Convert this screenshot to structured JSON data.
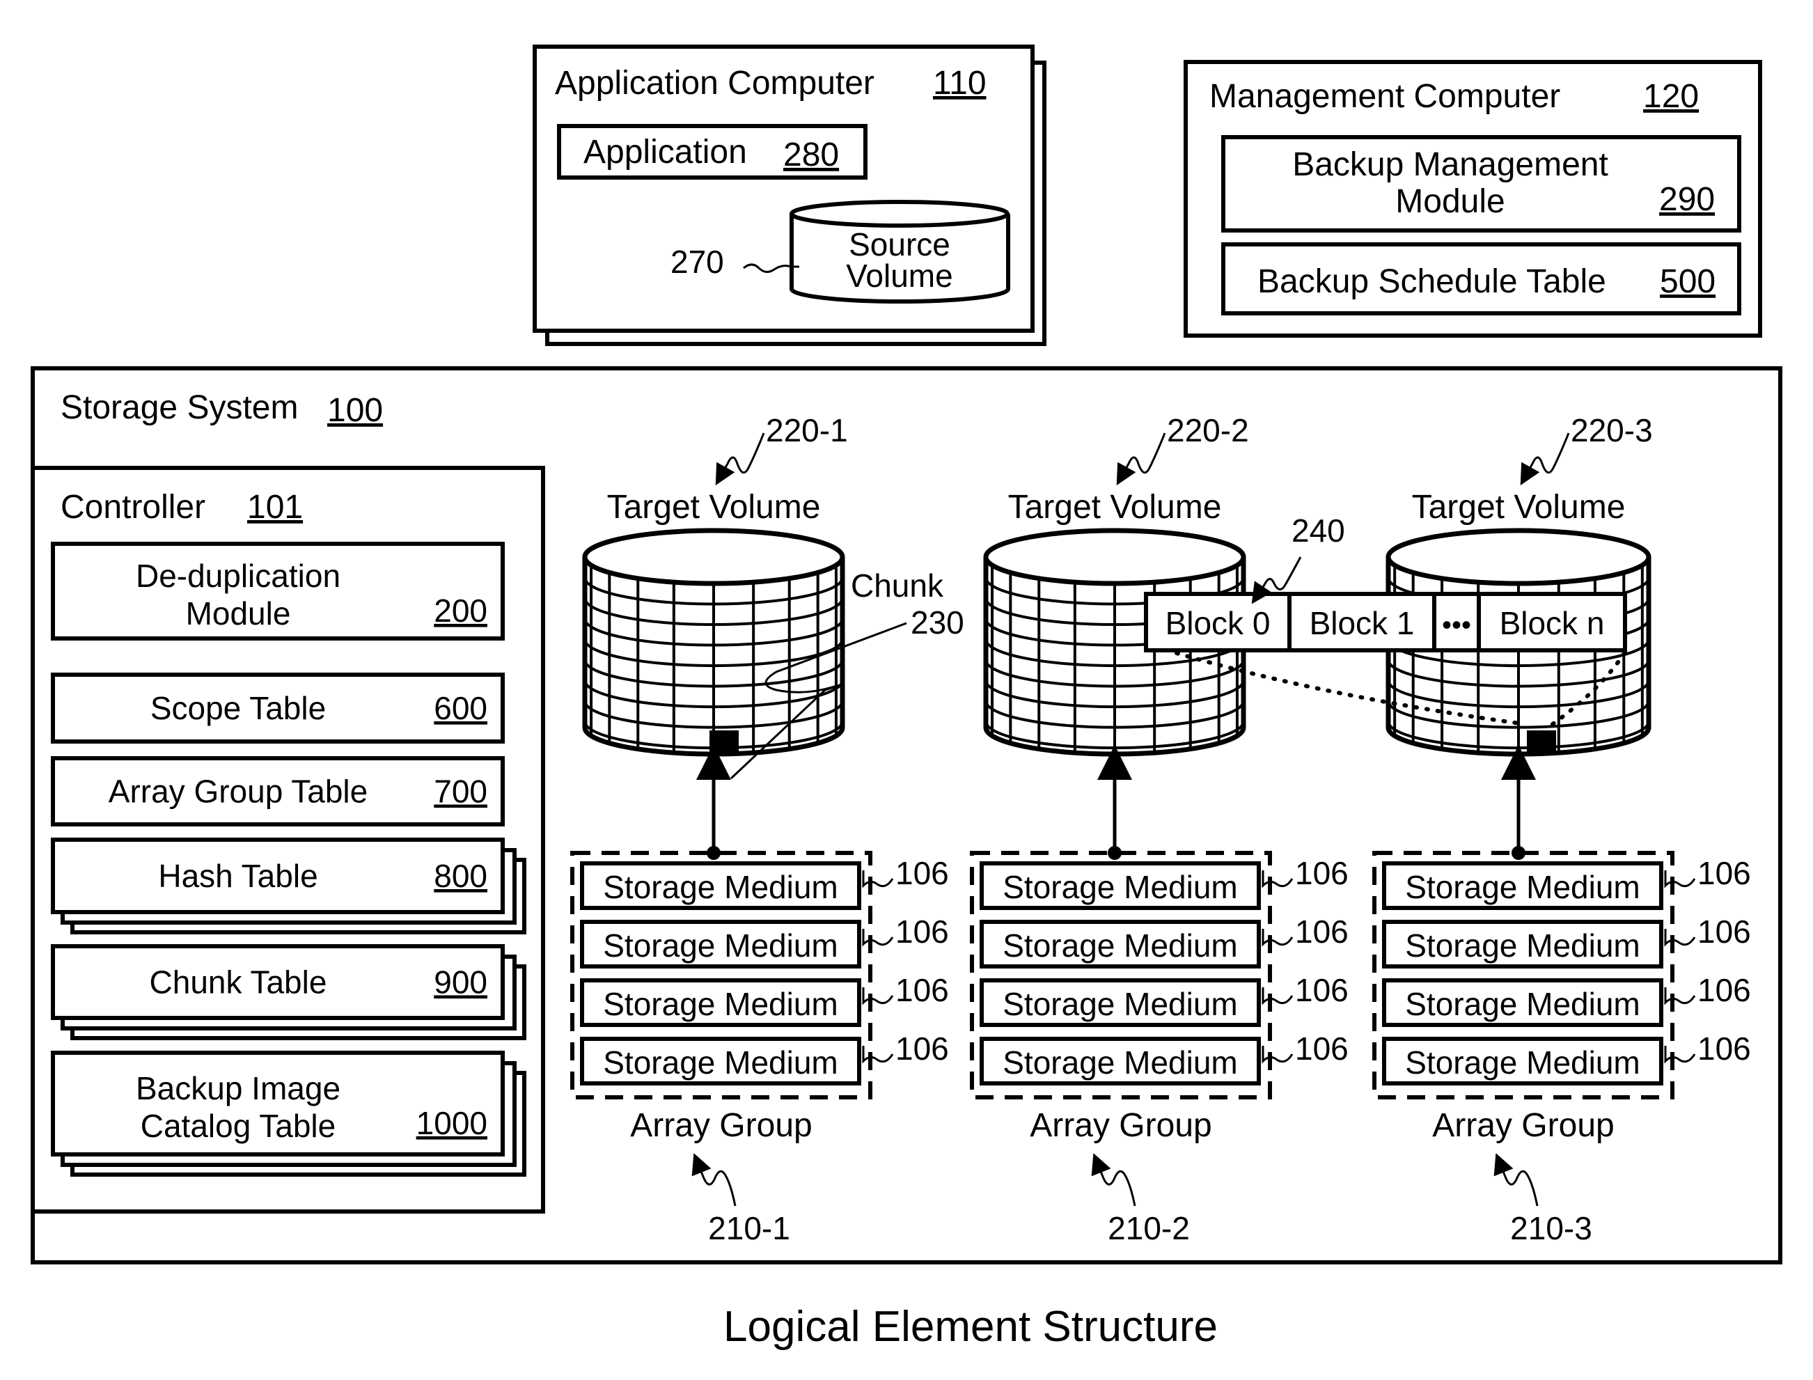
{
  "caption": "Logical Element Structure",
  "application_computer": {
    "title": "Application Computer",
    "ref": "110",
    "application": {
      "label": "Application",
      "ref": "280"
    },
    "source_volume": {
      "line1": "Source",
      "line2": "Volume",
      "ref": "270"
    }
  },
  "management_computer": {
    "title": "Management Computer",
    "ref": "120",
    "backup_management_module": {
      "line1": "Backup Management",
      "line2": "Module",
      "ref": "290"
    },
    "backup_schedule_table": {
      "label": "Backup Schedule Table",
      "ref": "500"
    }
  },
  "storage_system": {
    "title": "Storage System",
    "ref": "100",
    "controller": {
      "title": "Controller",
      "ref": "101",
      "modules": [
        {
          "line1": "De-duplication",
          "line2": "Module",
          "ref": "200",
          "stacked": false
        },
        {
          "line1": "Scope Table",
          "line2": "",
          "ref": "600",
          "stacked": false
        },
        {
          "line1": "Array Group Table",
          "line2": "",
          "ref": "700",
          "stacked": false
        },
        {
          "line1": "Hash Table",
          "line2": "",
          "ref": "800",
          "stacked": true
        },
        {
          "line1": "Chunk Table",
          "line2": "",
          "ref": "900",
          "stacked": true
        },
        {
          "line1": "Backup Image",
          "line2": "Catalog Table",
          "ref": "1000",
          "stacked": true
        }
      ]
    },
    "target_volumes": [
      {
        "label": "Target Volume",
        "ref": "220-1",
        "has_chunk": true
      },
      {
        "label": "Target Volume",
        "ref": "220-2",
        "has_chunk": false
      },
      {
        "label": "Target Volume",
        "ref": "220-3",
        "has_chunk": true
      }
    ],
    "chunk": {
      "label": "Chunk",
      "ref": "230"
    },
    "block_strip": {
      "ref": "240",
      "blocks": [
        "Block 0",
        "Block 1",
        "•••",
        "Block n"
      ]
    },
    "array_groups": [
      {
        "label": "Array Group",
        "ref": "210-1",
        "media": [
          "Storage Medium",
          "Storage Medium",
          "Storage Medium",
          "Storage Medium"
        ],
        "medium_ref": "106"
      },
      {
        "label": "Array Group",
        "ref": "210-2",
        "media": [
          "Storage Medium",
          "Storage Medium",
          "Storage Medium",
          "Storage Medium"
        ],
        "medium_ref": "106"
      },
      {
        "label": "Array Group",
        "ref": "210-3",
        "media": [
          "Storage Medium",
          "Storage Medium",
          "Storage Medium",
          "Storage Medium"
        ],
        "medium_ref": "106"
      }
    ]
  }
}
